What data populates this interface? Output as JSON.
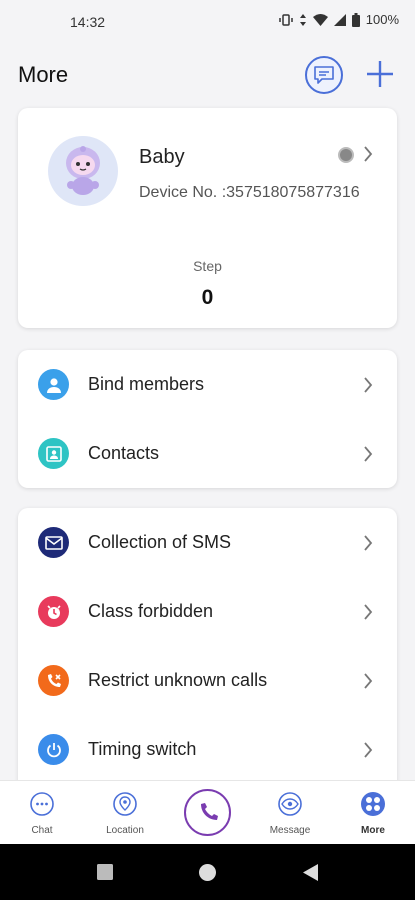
{
  "status_bar": {
    "time": "14:32",
    "battery": "100%"
  },
  "header": {
    "title": "More",
    "chat_icon": "message-bubble-icon",
    "add_icon": "plus-icon"
  },
  "profile": {
    "name": "Baby",
    "device_no": "Device No. :357518075877316",
    "step_label": "Step",
    "step_value": "0",
    "status_color": "#888888"
  },
  "menu_group_1": [
    {
      "label": "Bind members",
      "icon": "person-icon",
      "color": "#3aa0ea"
    },
    {
      "label": "Contacts",
      "icon": "contacts-card-icon",
      "color": "#2ec4c4"
    }
  ],
  "menu_group_2": [
    {
      "label": "Collection of SMS",
      "icon": "envelope-icon",
      "color": "#1e2a78"
    },
    {
      "label": "Class forbidden",
      "icon": "alarm-icon",
      "color": "#e83a5c"
    },
    {
      "label": "Restrict unknown calls",
      "icon": "phone-blocked-icon",
      "color": "#f26a1b"
    },
    {
      "label": "Timing switch",
      "icon": "power-icon",
      "color": "#3a8cea"
    }
  ],
  "bottom_nav": {
    "chat": "Chat",
    "location": "Location",
    "message": "Message",
    "more": "More",
    "accent": "#4a6fd8",
    "call_color": "#7a3cb0"
  }
}
